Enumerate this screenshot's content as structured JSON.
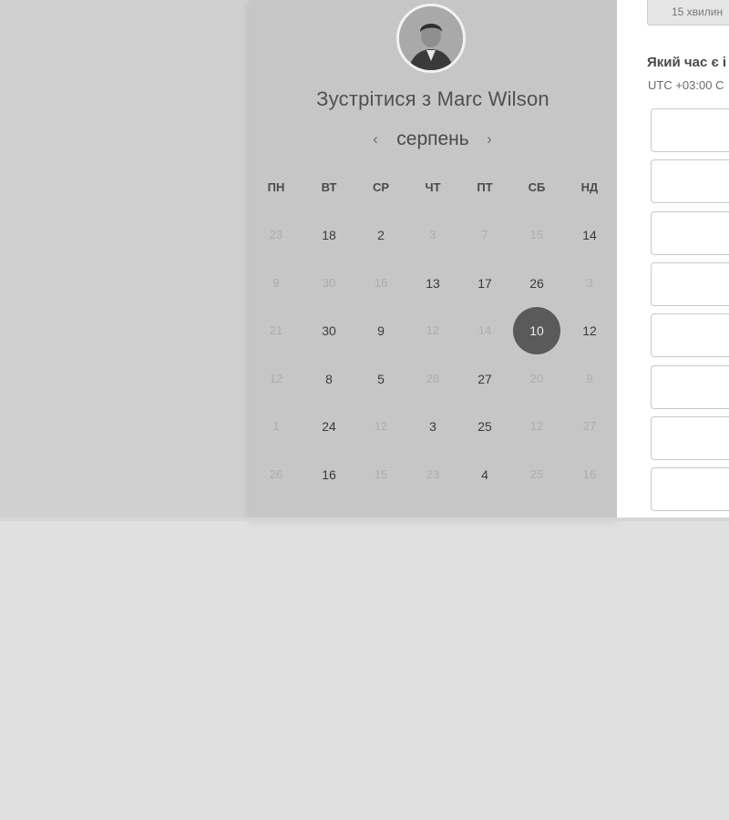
{
  "card": {
    "title": "Зустрітися з Marc Wilson",
    "month": "серпень",
    "prev_icon": "‹",
    "next_icon": "›",
    "weekdays": [
      "ПН",
      "ВТ",
      "СР",
      "ЧТ",
      "ПТ",
      "СБ",
      "НД"
    ],
    "weeks": [
      [
        {
          "d": "23",
          "a": false
        },
        {
          "d": "18",
          "a": true
        },
        {
          "d": "2",
          "a": true
        },
        {
          "d": "3",
          "a": false
        },
        {
          "d": "7",
          "a": false
        },
        {
          "d": "15",
          "a": false
        },
        {
          "d": "14",
          "a": true
        }
      ],
      [
        {
          "d": "9",
          "a": false
        },
        {
          "d": "30",
          "a": false
        },
        {
          "d": "16",
          "a": false
        },
        {
          "d": "13",
          "a": true
        },
        {
          "d": "17",
          "a": true
        },
        {
          "d": "26",
          "a": true
        },
        {
          "d": "3",
          "a": false
        }
      ],
      [
        {
          "d": "21",
          "a": false
        },
        {
          "d": "30",
          "a": true
        },
        {
          "d": "9",
          "a": true
        },
        {
          "d": "12",
          "a": false
        },
        {
          "d": "14",
          "a": false
        },
        {
          "d": "10",
          "a": true,
          "selected": true
        },
        {
          "d": "12",
          "a": true
        }
      ],
      [
        {
          "d": "12",
          "a": false
        },
        {
          "d": "8",
          "a": true
        },
        {
          "d": "5",
          "a": true
        },
        {
          "d": "28",
          "a": false
        },
        {
          "d": "27",
          "a": true
        },
        {
          "d": "20",
          "a": false
        },
        {
          "d": "9",
          "a": false
        }
      ],
      [
        {
          "d": "1",
          "a": false
        },
        {
          "d": "24",
          "a": true
        },
        {
          "d": "12",
          "a": false
        },
        {
          "d": "3",
          "a": true
        },
        {
          "d": "25",
          "a": true
        },
        {
          "d": "12",
          "a": false
        },
        {
          "d": "27",
          "a": false
        }
      ],
      [
        {
          "d": "26",
          "a": false
        },
        {
          "d": "16",
          "a": true
        },
        {
          "d": "15",
          "a": false
        },
        {
          "d": "23",
          "a": false
        },
        {
          "d": "4",
          "a": true
        },
        {
          "d": "25",
          "a": false
        },
        {
          "d": "16",
          "a": false
        }
      ]
    ]
  },
  "right": {
    "duration_label": "15 хвилин",
    "time_question": "Який час є і",
    "timezone": "UTC +03:00 С",
    "slot_count": 8
  },
  "colors": {
    "page_bg": "#e0e0e0",
    "card_bg": "#c6c6c6",
    "selected_day_bg": "#5a5a5a"
  }
}
